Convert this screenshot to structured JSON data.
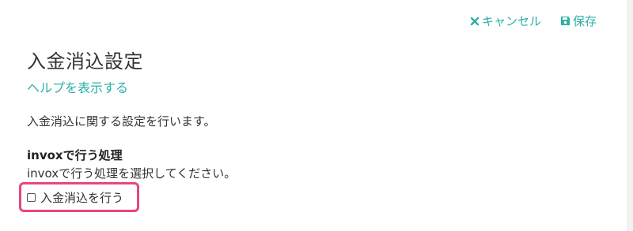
{
  "header": {
    "cancel_label": "キャンセル",
    "save_label": "保存"
  },
  "page": {
    "title": "入金消込設定",
    "help_link": "ヘルプを表示する",
    "description": "入金消込に関する設定を行います。"
  },
  "section": {
    "title": "invoxで行う処理",
    "description": "invoxで行う処理を選択してください。",
    "option_label": "入金消込を行う",
    "option_checked": false
  },
  "colors": {
    "accent": "#2bb0a6",
    "highlight": "#e8467c",
    "text": "#333333"
  }
}
